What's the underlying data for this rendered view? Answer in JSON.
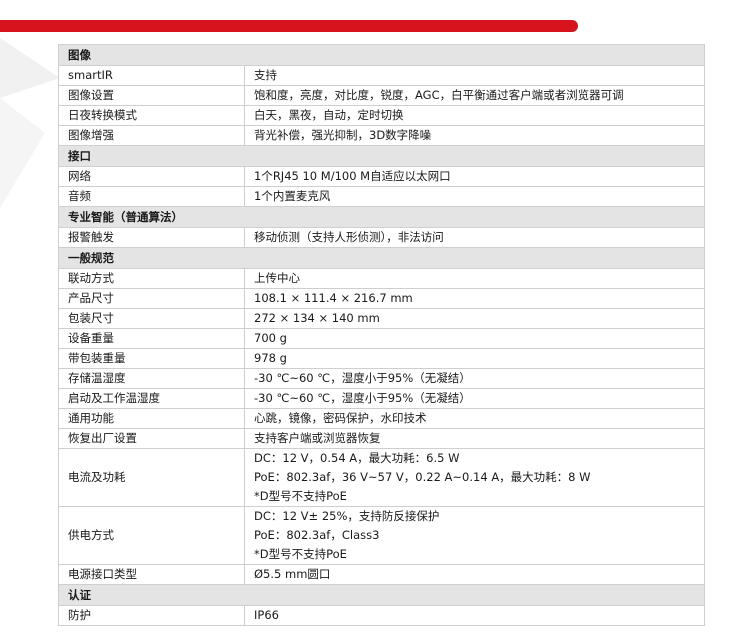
{
  "sections": [
    {
      "title": "图像",
      "rows": [
        {
          "key": "smartIR",
          "lines": [
            "支持"
          ]
        },
        {
          "key": "图像设置",
          "lines": [
            "饱和度，亮度，对比度，锐度，AGC，白平衡通过客户端或者浏览器可调"
          ]
        },
        {
          "key": "日夜转换模式",
          "lines": [
            "白天，黑夜，自动，定时切换"
          ]
        },
        {
          "key": "图像增强",
          "lines": [
            "背光补偿，强光抑制，3D数字降噪"
          ]
        }
      ]
    },
    {
      "title": "接口",
      "rows": [
        {
          "key": "网络",
          "lines": [
            "1个RJ45 10 M/100 M自适应以太网口"
          ]
        },
        {
          "key": "音频",
          "lines": [
            "1个内置麦克风"
          ]
        }
      ]
    },
    {
      "title": "专业智能（普通算法）",
      "rows": [
        {
          "key": "报警触发",
          "lines": [
            "移动侦测（支持人形侦测），非法访问"
          ]
        }
      ]
    },
    {
      "title": "一般规范",
      "rows": [
        {
          "key": "联动方式",
          "lines": [
            "上传中心"
          ]
        },
        {
          "key": "产品尺寸",
          "lines": [
            "108.1 × 111.4 × 216.7 mm"
          ]
        },
        {
          "key": "包装尺寸",
          "lines": [
            "272 × 134 × 140 mm"
          ]
        },
        {
          "key": "设备重量",
          "lines": [
            "700 g"
          ]
        },
        {
          "key": "带包装重量",
          "lines": [
            "978 g"
          ]
        },
        {
          "key": "存储温湿度",
          "lines": [
            "-30 ℃~60 ℃，湿度小于95%（无凝结）"
          ]
        },
        {
          "key": "启动及工作温湿度",
          "lines": [
            "-30 ℃~60 ℃，湿度小于95%（无凝结）"
          ]
        },
        {
          "key": "通用功能",
          "lines": [
            "心跳，镜像，密码保护，水印技术"
          ]
        },
        {
          "key": "恢复出厂设置",
          "lines": [
            "支持客户端或浏览器恢复"
          ]
        },
        {
          "key": "电流及功耗",
          "lines": [
            "DC：12 V，0.54 A，最大功耗：6.5 W",
            "PoE：802.3af，36 V~57 V，0.22 A~0.14 A，最大功耗：8 W",
            "*D型号不支持PoE"
          ]
        },
        {
          "key": "供电方式",
          "lines": [
            "DC：12 V± 25%，支持防反接保护",
            "PoE：802.3af，Class3",
            "*D型号不支持PoE"
          ]
        },
        {
          "key": "电源接口类型",
          "lines": [
            "Ø5.5 mm圆口"
          ]
        }
      ]
    },
    {
      "title": "认证",
      "rows": [
        {
          "key": "防护",
          "lines": [
            "IP66"
          ]
        }
      ]
    }
  ]
}
